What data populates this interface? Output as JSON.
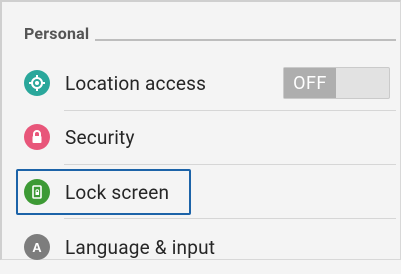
{
  "section": {
    "title": "Personal"
  },
  "items": [
    {
      "label": "Location access",
      "icon": "location-icon",
      "color": "#2aa79b",
      "toggle": "OFF"
    },
    {
      "label": "Security",
      "icon": "lock-icon",
      "color": "#e8567a"
    },
    {
      "label": "Lock screen",
      "icon": "lock-screen-icon",
      "color": "#3d9a35",
      "focused": true
    },
    {
      "label": "Language & input",
      "icon": "language-icon",
      "color": "#7d7d7d"
    }
  ],
  "colors": {
    "focus_outline": "#1c63a8",
    "background": "#f4f4f4"
  }
}
